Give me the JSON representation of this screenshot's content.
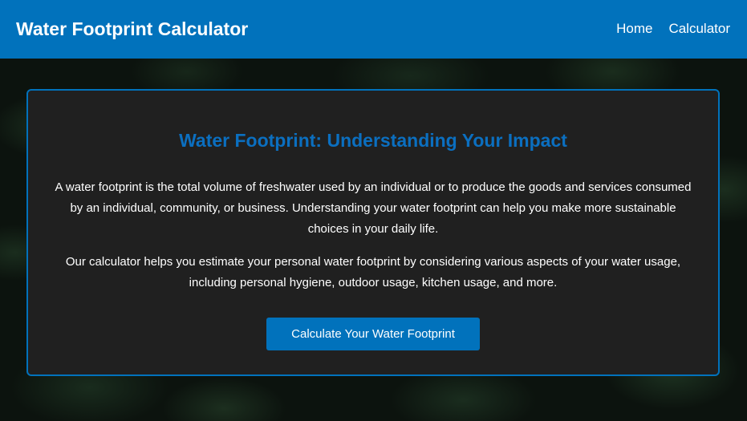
{
  "header": {
    "brand": "Water Footprint Calculator",
    "nav": [
      {
        "label": "Home"
      },
      {
        "label": "Calculator"
      }
    ]
  },
  "intro": {
    "title": "Water Footprint: Understanding Your Impact",
    "paragraph_1": "A water footprint is the total volume of freshwater used by an individual or to produce the goods and services consumed by an individual, community, or business. Understanding your water footprint can help you make more sustainable choices in your daily life.",
    "paragraph_2": "Our calculator helps you estimate your personal water footprint by considering various aspects of your water usage, including personal hygiene, outdoor usage, kitchen usage, and more.",
    "cta_label": "Calculate Your Water Footprint"
  },
  "colors": {
    "primary": "#0172bc",
    "card_background": "#202020",
    "page_background": "#0c130e"
  }
}
